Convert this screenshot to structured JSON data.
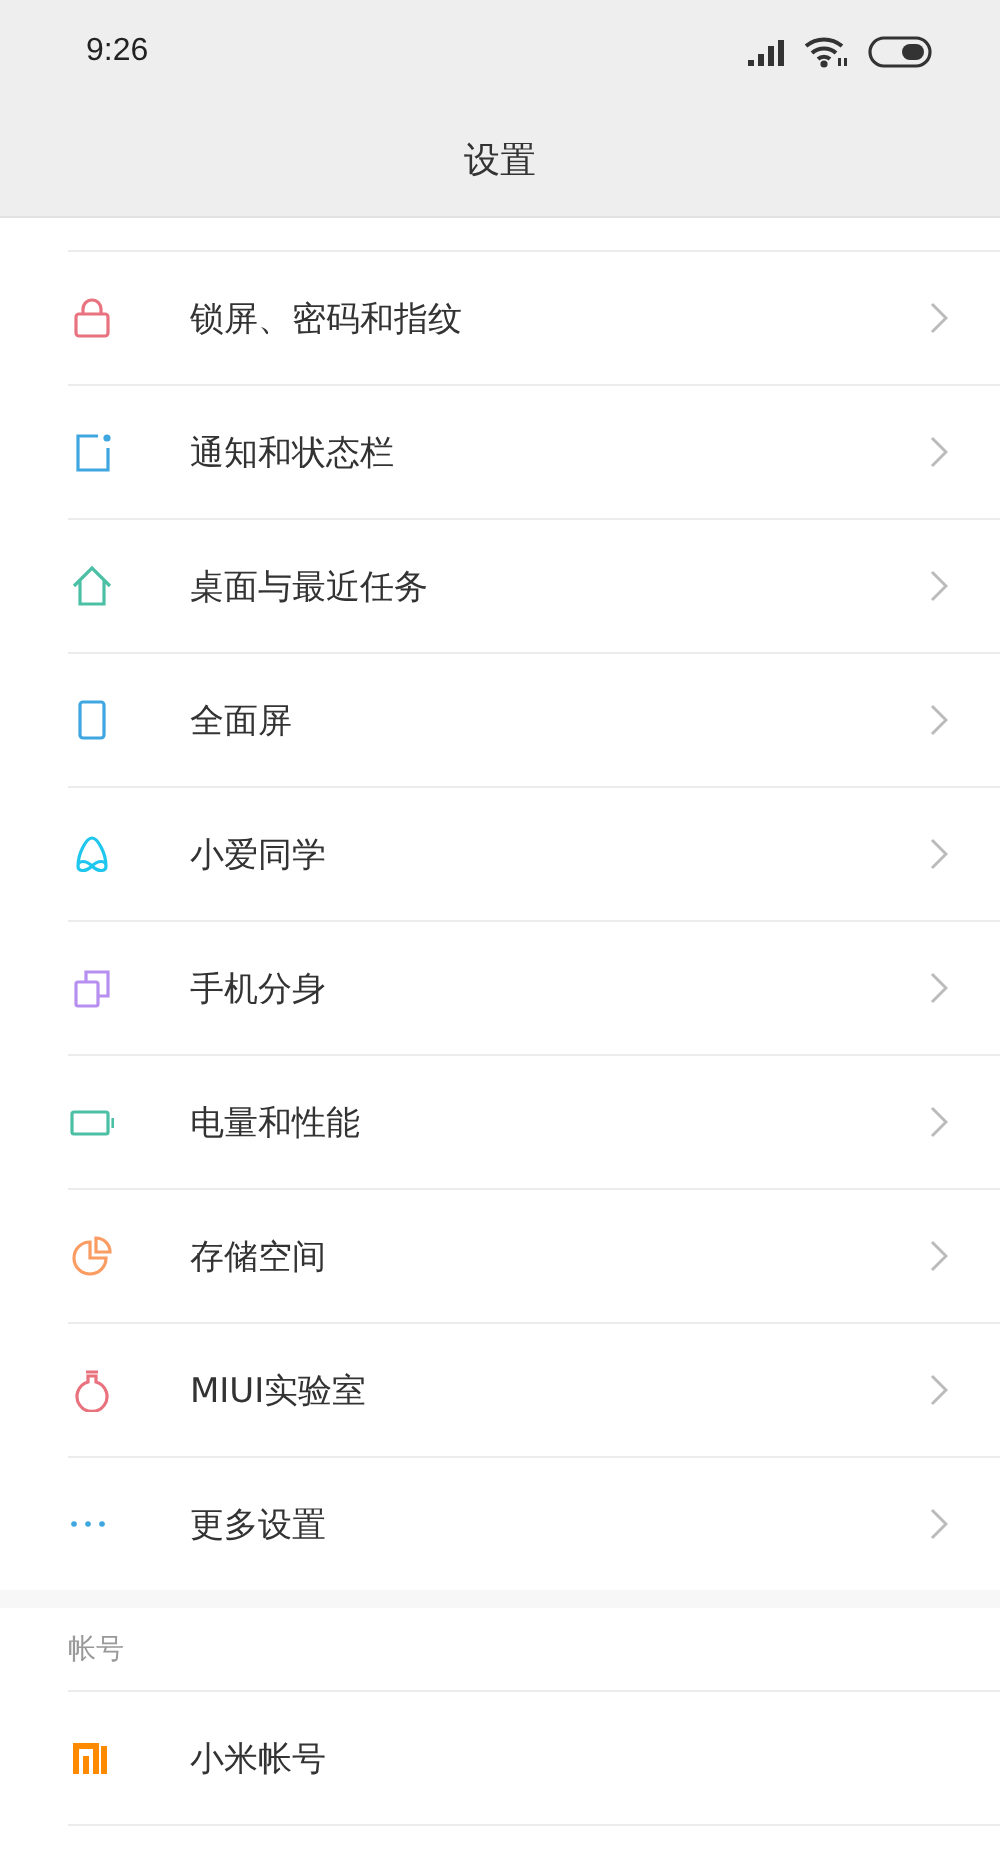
{
  "status_bar": {
    "time": "9:26"
  },
  "title": "设置",
  "sections": [
    {
      "items": [
        {
          "label": "锁屏、密码和指纹",
          "kind": "lock",
          "color": "#e8737f",
          "chevron": true
        },
        {
          "label": "通知和状态栏",
          "kind": "notify",
          "color": "#3ea6e0",
          "chevron": true
        },
        {
          "label": "桌面与最近任务",
          "kind": "home",
          "color": "#4cc0a4",
          "chevron": true
        },
        {
          "label": "全面屏",
          "kind": "phone",
          "color": "#3ea6e0",
          "chevron": true
        },
        {
          "label": "小爱同学",
          "kind": "assistant",
          "color": "#1fc6ee",
          "chevron": true
        },
        {
          "label": "手机分身",
          "kind": "dual",
          "color": "#b68ff0",
          "chevron": true
        },
        {
          "label": "电量和性能",
          "kind": "battery",
          "color": "#4cc0a4",
          "chevron": true
        },
        {
          "label": "存储空间",
          "kind": "storage",
          "color": "#fb9c63",
          "chevron": true
        },
        {
          "label": "MIUI实验室",
          "kind": "flask",
          "color": "#e8737f",
          "chevron": true
        },
        {
          "label": "更多设置",
          "kind": "more",
          "color": "#3ea6e0",
          "chevron": true
        }
      ]
    },
    {
      "header": "帐号",
      "items": [
        {
          "label": "小米帐号",
          "kind": "mi",
          "color": "#ff8a00",
          "chevron": false
        }
      ]
    }
  ]
}
